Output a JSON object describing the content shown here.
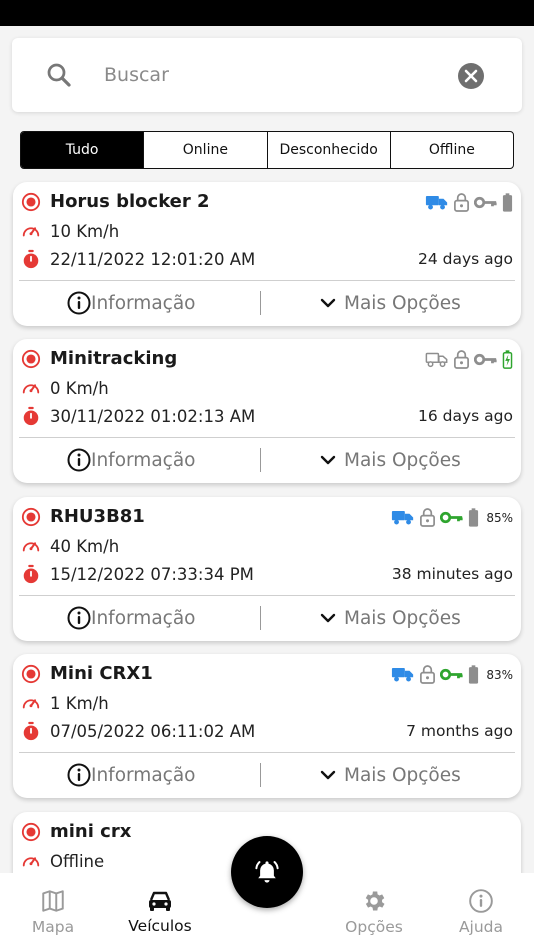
{
  "search": {
    "placeholder": "Buscar"
  },
  "filters": [
    "Tudo",
    "Online",
    "Desconhecido",
    "Offline"
  ],
  "colors": {
    "accent_red": "#e53935",
    "truck_blue": "#2f8be6",
    "key_green": "#2fa52f",
    "icon_gray": "#8e8e8e"
  },
  "vehicles": [
    {
      "name": "Horus blocker 2",
      "speed": "10 Km/h",
      "date": "22/11/2022 12:01:20 AM",
      "ago": "24 days ago",
      "battery": ""
    },
    {
      "name": "Minitracking",
      "speed": "0 Km/h",
      "date": "30/11/2022 01:02:13 AM",
      "ago": "16 days ago",
      "battery": ""
    },
    {
      "name": "RHU3B81",
      "speed": "40 Km/h",
      "date": "15/12/2022 07:33:34 PM",
      "ago": "38 minutes ago",
      "battery": "85%"
    },
    {
      "name": "Mini CRX1",
      "speed": "1 Km/h",
      "date": "07/05/2022 06:11:02 AM",
      "ago": "7 months ago",
      "battery": "83%"
    },
    {
      "name": "mini crx",
      "speed": "Offline"
    }
  ],
  "actions": {
    "info": "Informação",
    "more": "Mais Opções"
  },
  "nav": {
    "map": "Mapa",
    "vehicles": "Veículos",
    "options": "Opções",
    "help": "Ajuda"
  }
}
